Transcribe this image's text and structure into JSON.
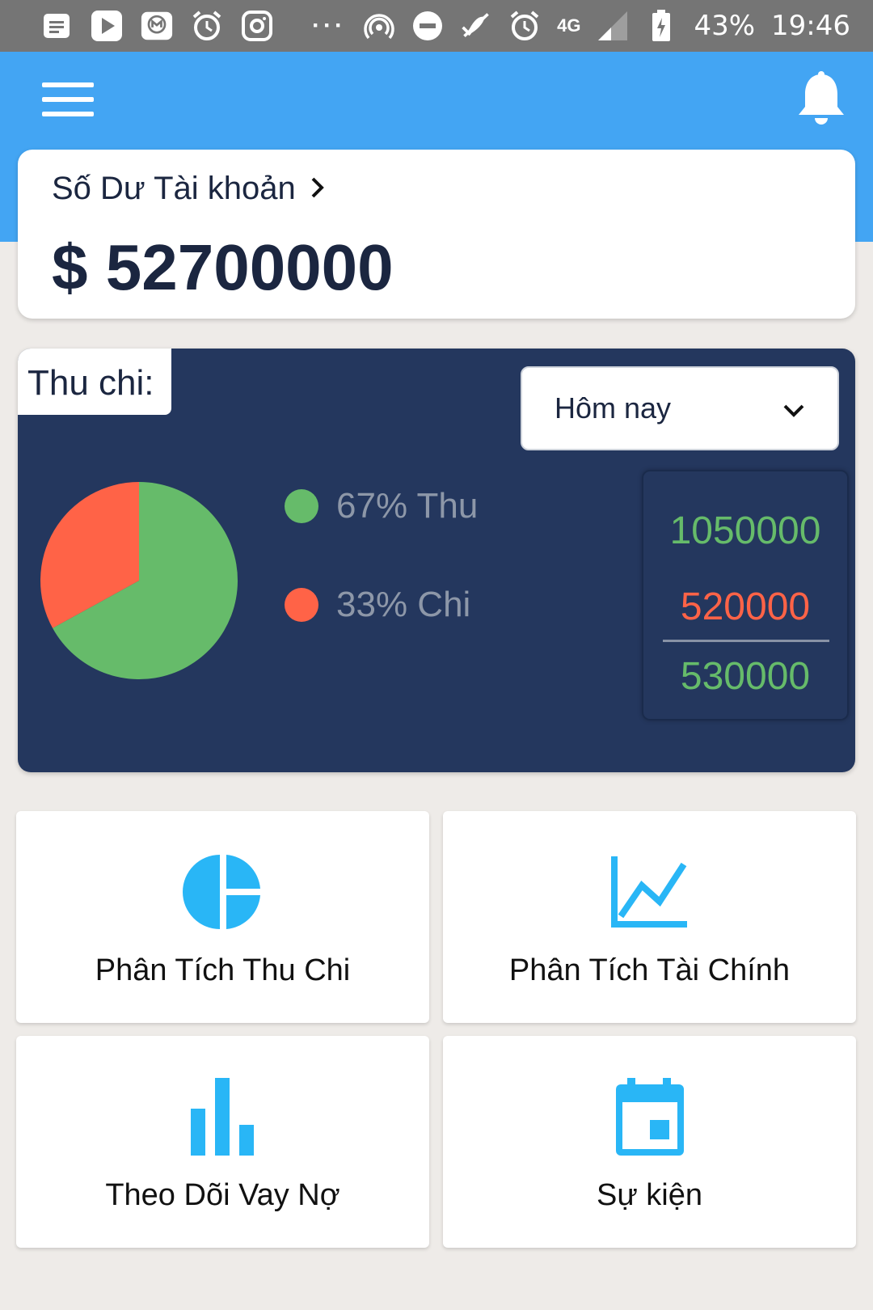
{
  "status_bar": {
    "battery": "43%",
    "time": "19:46",
    "network": "4G",
    "more": "···",
    "left_icons": [
      "notes-icon",
      "play-icon",
      "mail-icon",
      "alarm-icon",
      "instagram-icon"
    ],
    "right_icons": [
      "hotspot-icon",
      "do-not-disturb-icon",
      "no-sound-icon",
      "alarm-icon",
      "signal-icon",
      "battery-icon"
    ]
  },
  "header": {
    "menu_icon": "hamburger-menu-icon",
    "bell_icon": "bell-icon",
    "color": "#43a5f3"
  },
  "balance": {
    "title": "Số Dư Tài khoản",
    "amount": "$ 52700000"
  },
  "thu_chi": {
    "label": "Thu chi:",
    "period": "Hôm nay",
    "legend": [
      {
        "text": "67% Thu",
        "color": "#66bb6a"
      },
      {
        "text": "33% Chi",
        "color": "#ff6347"
      }
    ],
    "totals": {
      "income": "1050000",
      "expense": "520000",
      "net": "530000"
    },
    "chart_data": {
      "type": "pie",
      "categories": [
        "Thu",
        "Chi"
      ],
      "values": [
        67,
        33
      ],
      "colors": [
        "#66bb6a",
        "#ff6347"
      ]
    }
  },
  "tiles": [
    {
      "label": "Phân Tích Thu Chi",
      "icon": "pie-chart-icon"
    },
    {
      "label": "Phân Tích Tài Chính",
      "icon": "line-chart-icon"
    },
    {
      "label": "Theo Dõi Vay Nợ",
      "icon": "bar-chart-icon"
    },
    {
      "label": "Sự kiện",
      "icon": "calendar-icon"
    }
  ],
  "colors": {
    "accent": "#29b6f6",
    "panel": "#24375e",
    "income": "#66bb6a",
    "expense": "#ff6347"
  }
}
